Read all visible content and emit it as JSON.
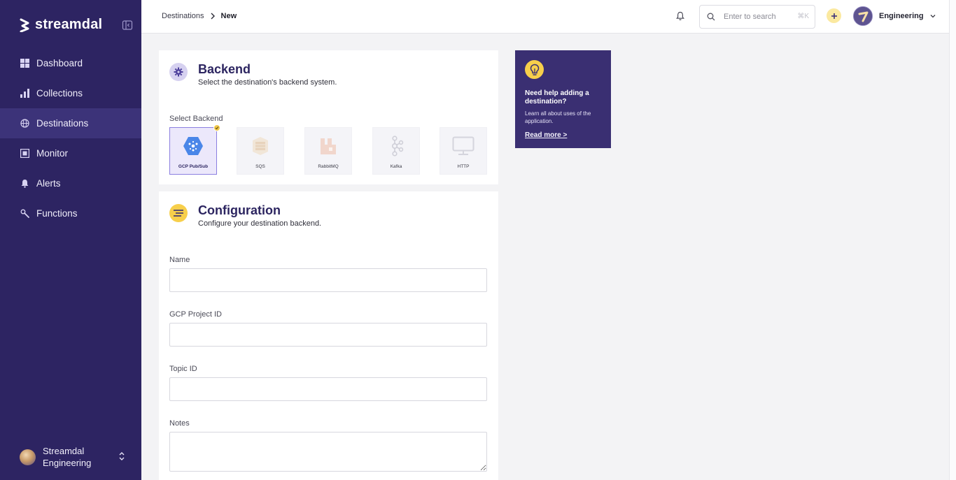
{
  "app": {
    "brand": "streamdal"
  },
  "sidebar": {
    "items": [
      {
        "label": "Dashboard",
        "icon": "dashboard-icon",
        "active": false
      },
      {
        "label": "Collections",
        "icon": "bar-chart-icon",
        "active": false
      },
      {
        "label": "Destinations",
        "icon": "globe-icon",
        "active": true
      },
      {
        "label": "Monitor",
        "icon": "monitor-icon",
        "active": false
      },
      {
        "label": "Alerts",
        "icon": "bell-icon",
        "active": false
      },
      {
        "label": "Functions",
        "icon": "wrench-icon",
        "active": false
      }
    ],
    "user": {
      "line1": "Streamdal",
      "line2": "Engineering"
    }
  },
  "topbar": {
    "breadcrumb": {
      "parent": "Destinations",
      "current": "New"
    },
    "search": {
      "placeholder": "Enter to search",
      "shortcut": "⌘K"
    },
    "org_name": "Engineering"
  },
  "backend_section": {
    "title": "Backend",
    "subtitle": "Select the destination's backend system.",
    "select_label": "Select Backend",
    "options": [
      {
        "label": "GCP Pub/Sub",
        "selected": true
      },
      {
        "label": "SQS",
        "selected": false
      },
      {
        "label": "RabbitMQ",
        "selected": false
      },
      {
        "label": "Kafka",
        "selected": false
      },
      {
        "label": "HTTP",
        "selected": false
      }
    ]
  },
  "config_section": {
    "title": "Configuration",
    "subtitle": "Configure your destination backend.",
    "fields": {
      "name": {
        "label": "Name",
        "value": ""
      },
      "project_id": {
        "label": "GCP Project ID",
        "value": ""
      },
      "topic_id": {
        "label": "Topic ID",
        "value": ""
      },
      "notes": {
        "label": "Notes",
        "value": ""
      }
    }
  },
  "help": {
    "title": "Need help adding a destination?",
    "body": "Learn all about uses of the application.",
    "link": "Read more >"
  },
  "colors": {
    "sidebar_bg": "#2d2462",
    "sidebar_active": "#3c3379",
    "accent_yellow": "#f7cf4b",
    "help_bg": "#3a2f72",
    "selected_tile_border": "#8b7fe0"
  }
}
